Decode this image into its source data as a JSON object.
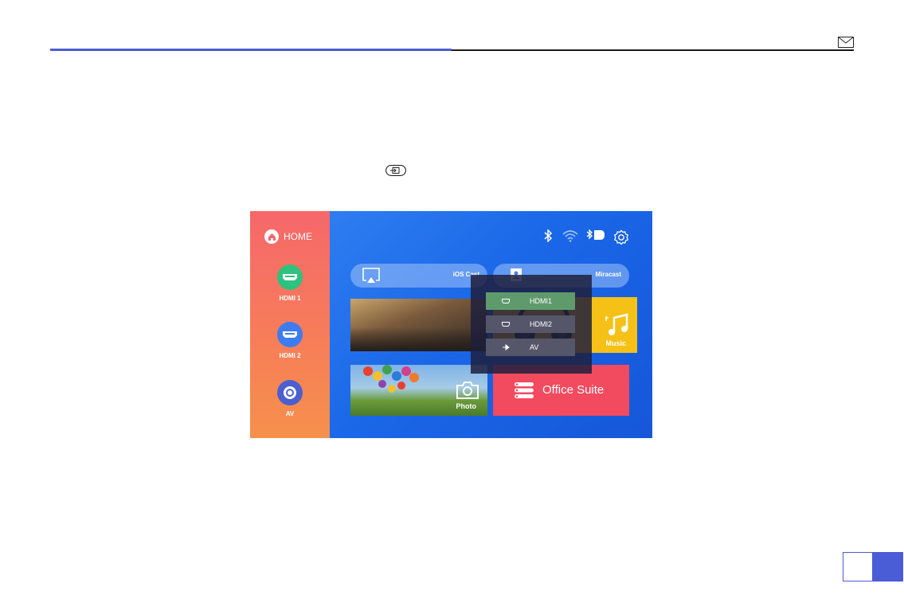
{
  "side": {
    "home_label": "HOME",
    "sources": [
      {
        "label": "HDMI 1",
        "icon": "hdmi-icon",
        "color": "#2ec27e"
      },
      {
        "label": "HDMI 2",
        "icon": "hdmi-icon",
        "color": "#3d7cf0"
      },
      {
        "label": "AV",
        "icon": "av-icon",
        "color": "#4b5fd0"
      }
    ]
  },
  "tiles": {
    "iscreen_label": "iOS Cast",
    "miracast_label": "Miracast",
    "music_label": "Music",
    "photo_label": "Photo",
    "office_label": "Office Suite"
  },
  "input_menu": {
    "options": [
      {
        "label": "HDMI1",
        "icon": "hdmi-icon",
        "selected": true
      },
      {
        "label": "HDMI2",
        "icon": "hdmi-icon",
        "selected": false
      },
      {
        "label": "AV",
        "icon": "av-icon",
        "selected": false
      }
    ]
  },
  "status_icons": [
    "bluetooth-icon",
    "wifi-icon",
    "bluetooth-speaker-icon",
    "gear-icon"
  ],
  "colors": {
    "accent_rule": "#4a5cd6",
    "selected_option": "#5f9a6c",
    "office_tile": "#f24a5f",
    "music_tile": "#f5c117"
  }
}
